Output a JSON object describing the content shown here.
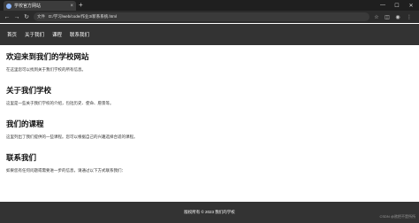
{
  "browser": {
    "tab_title": "学校官方网站",
    "tab_close": "×",
    "new_tab": "+",
    "window_controls": [
      "—",
      "☐",
      "✕"
    ],
    "nav_buttons": [
      "←",
      "→",
      "↻"
    ],
    "address_label": "文件",
    "address_url": "D:/学习/web/code/作业3/新系系统.html",
    "toolbar_icons": [
      "☆",
      "◫",
      "◉",
      "⋮"
    ]
  },
  "nav": {
    "items": [
      "首页",
      "关于我们",
      "课程",
      "联系我们"
    ]
  },
  "sections": [
    {
      "heading": "欢迎来到我们的学校网站",
      "text": "在这里您可以找到关于我们学校的所有信息。"
    },
    {
      "heading": "关于我们学校",
      "text": "这里是一些关于我们学校的介绍，包括历史、使命、愿景等。"
    },
    {
      "heading": "我们的课程",
      "text": "这里列出了我们提供的一些课程。您可以根据自己的兴趣选择合适的课程。"
    },
    {
      "heading": "联系我们",
      "text": "如果您有任何问题或需要进一步的信息，请通过以下方式联系我们："
    }
  ],
  "footer": {
    "text": "版权所有 © 2023 我们的学校"
  },
  "watermark": "CSDN @欲把不是所所"
}
